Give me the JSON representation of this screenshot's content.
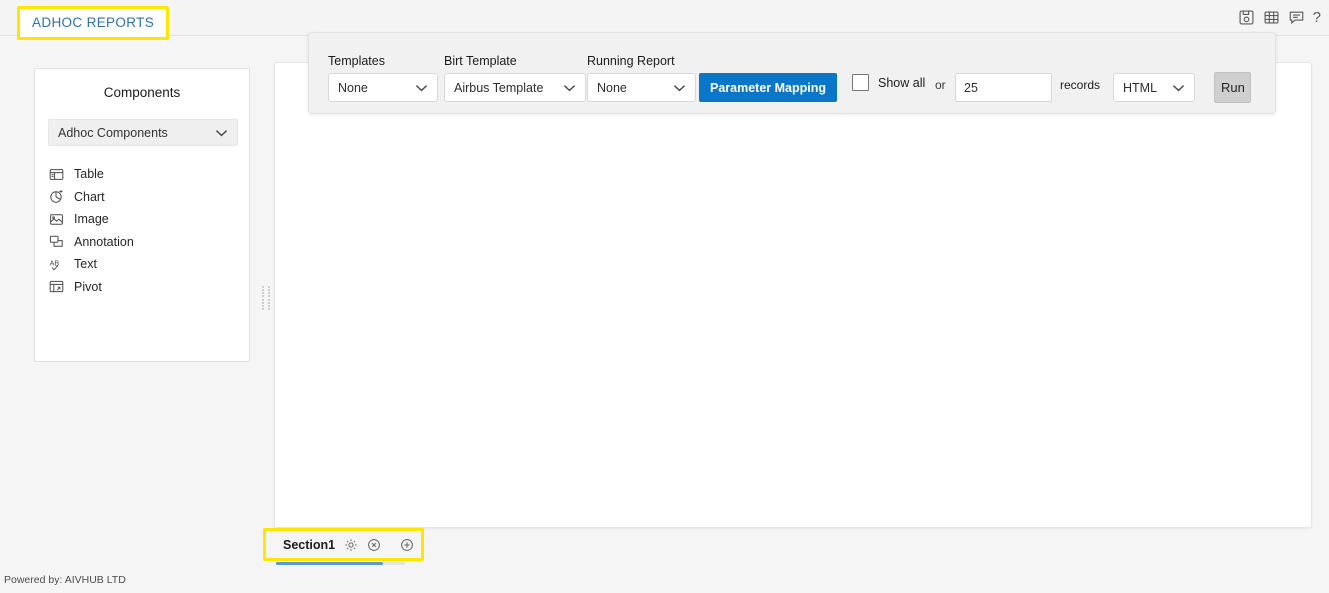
{
  "header": {
    "brand": "ADHOC REPORTS",
    "icons": [
      {
        "name": "save-icon",
        "title": "Save"
      },
      {
        "name": "table-grid-icon",
        "title": "Grid"
      },
      {
        "name": "comment-icon",
        "title": "Comments"
      }
    ],
    "help_label": "?"
  },
  "components": {
    "title": "Components",
    "category_select": {
      "value": "Adhoc Components",
      "icon": "chevron-down-icon"
    },
    "items": [
      {
        "label": "Table",
        "icon": "table-icon"
      },
      {
        "label": "Chart",
        "icon": "pie-chart-icon"
      },
      {
        "label": "Image",
        "icon": "image-icon"
      },
      {
        "label": "Annotation",
        "icon": "annotation-icon"
      },
      {
        "label": "Text",
        "icon": "text-spellcheck-icon"
      },
      {
        "label": "Pivot",
        "icon": "pivot-table-icon"
      }
    ]
  },
  "toolbar": {
    "templates": {
      "label": "Templates",
      "value": "None"
    },
    "birt_template": {
      "label": "Birt Template",
      "value": "Airbus Template"
    },
    "running_report": {
      "label": "Running Report",
      "value": "None"
    },
    "parameter_mapping_label": "Parameter Mapping",
    "show_all_label": "Show all",
    "show_all_checked": false,
    "or_label": "or",
    "records_value": "25",
    "records_placeholder": "25",
    "records_label": "records",
    "format": {
      "value": "HTML"
    },
    "run_label": "Run"
  },
  "sections": {
    "active_tab": "Section1",
    "settings_icon": "gear-icon",
    "close_icon": "close-circle-icon",
    "add_icon": "add-circle-icon"
  },
  "footer": {
    "text": "Powered by: AIVHUB LTD"
  },
  "colors": {
    "brand_text": "#2f6fad",
    "highlight": "#ffe600",
    "primary_button": "#0a76c8",
    "tab_underline": "#5b9bd5",
    "page_background": "#f5f5f5"
  }
}
